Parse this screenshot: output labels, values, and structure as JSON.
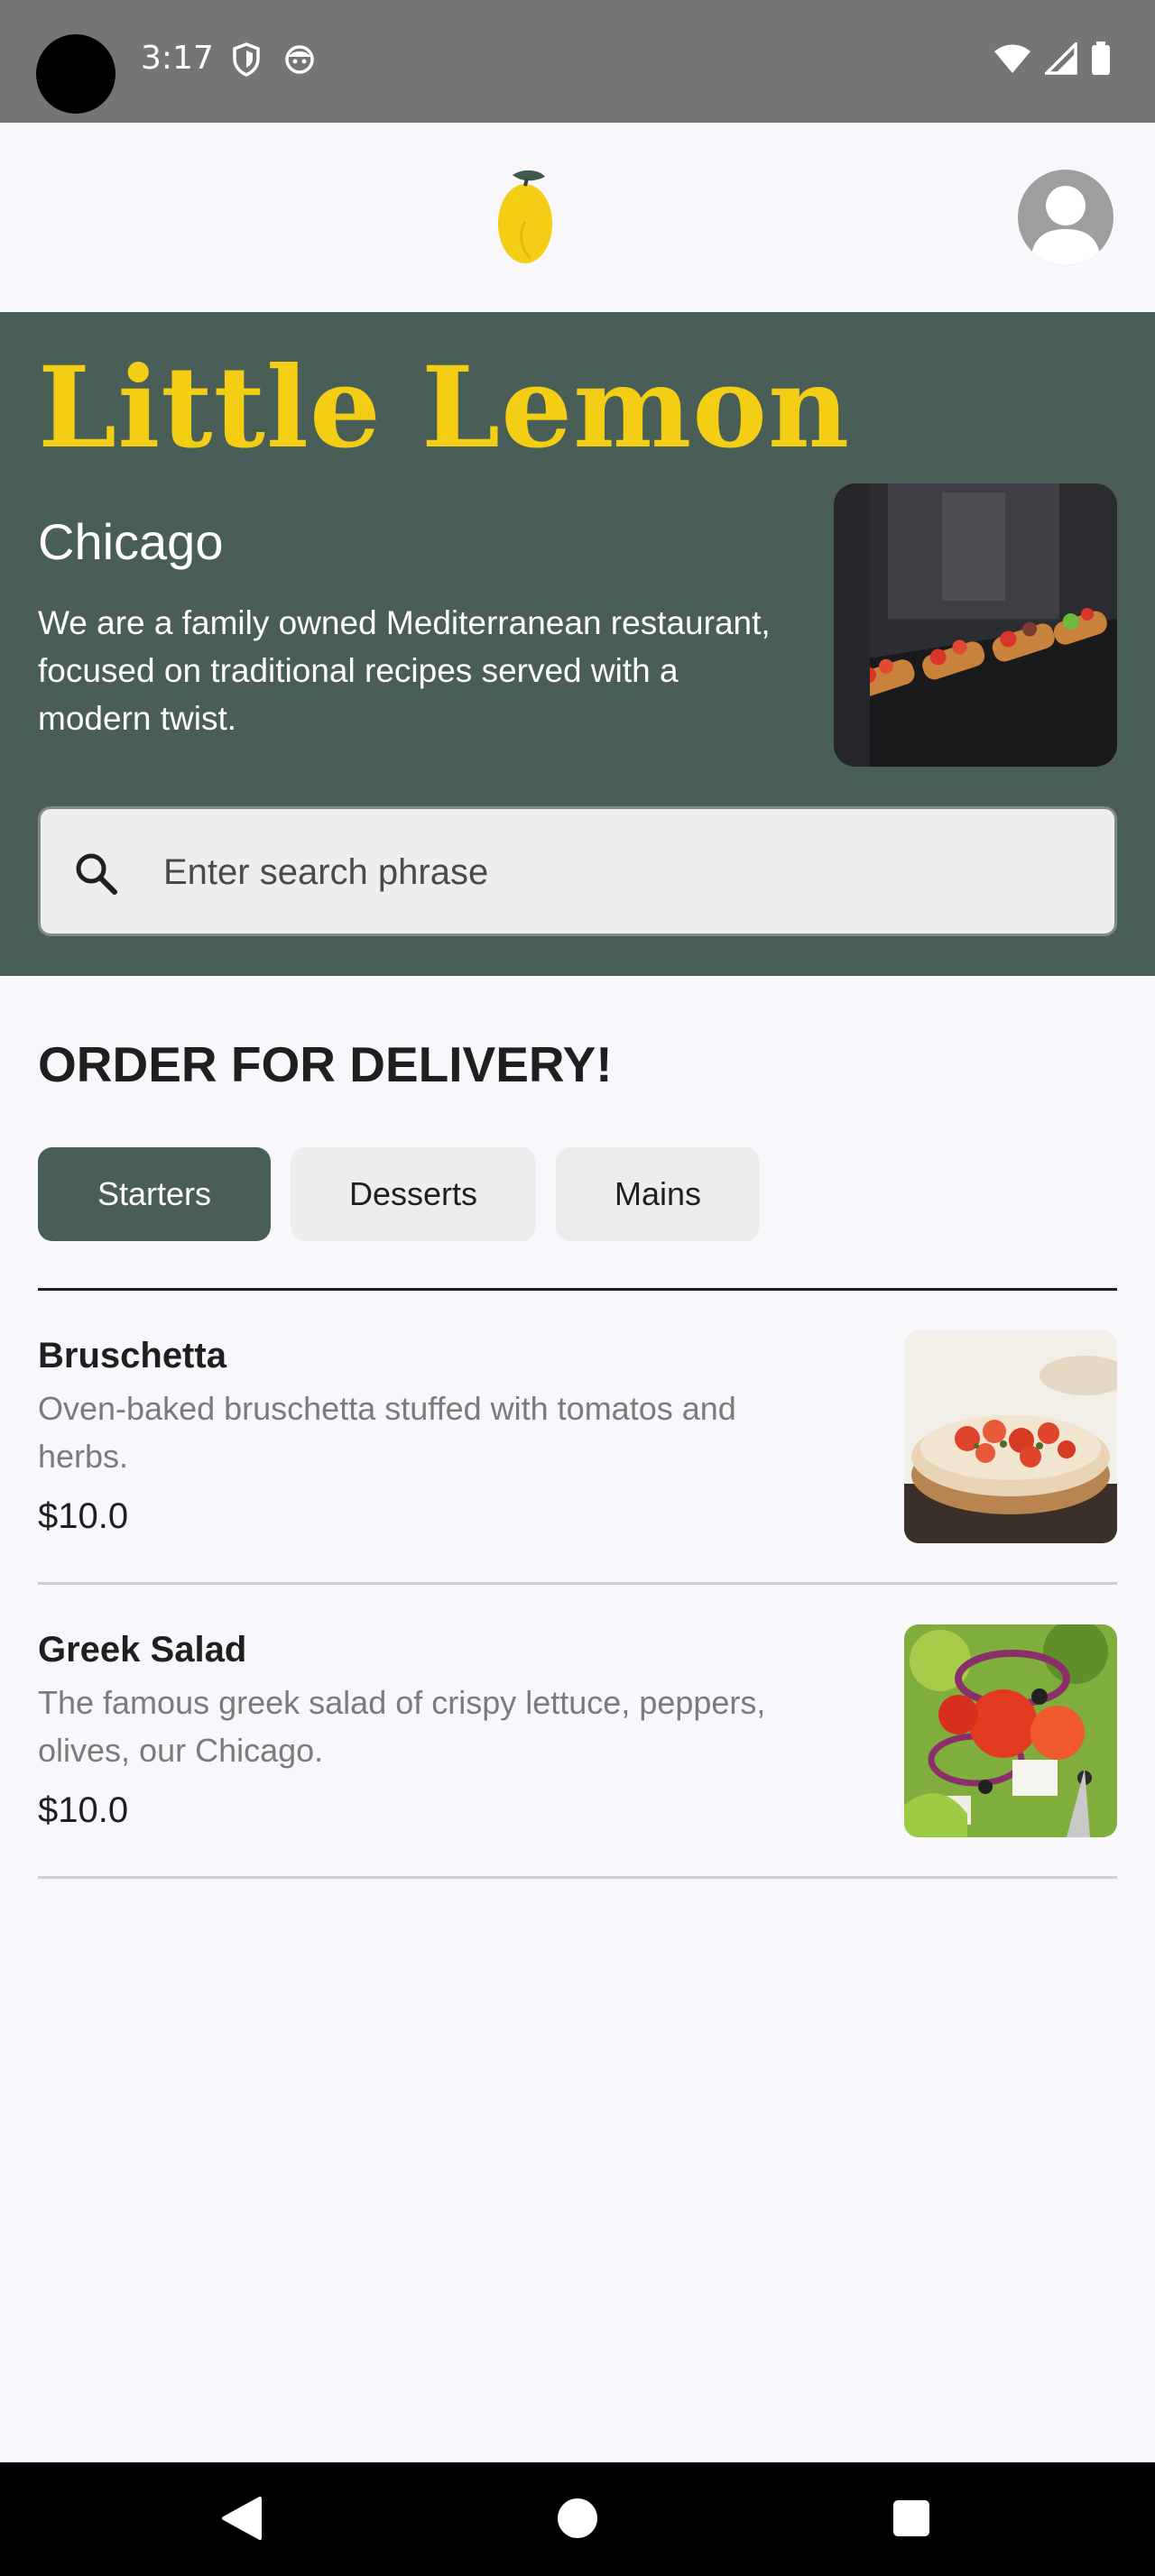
{
  "status_bar": {
    "time": "3:17",
    "icons_left": [
      "shield-icon",
      "face-icon"
    ],
    "icons_right": [
      "wifi-icon",
      "signal-icon",
      "battery-icon"
    ]
  },
  "app_bar": {
    "logo_icon": "lemon-logo-icon",
    "profile_icon": "avatar-icon"
  },
  "hero": {
    "title": "Little Lemon",
    "city": "Chicago",
    "description": "We are a family owned Mediterranean restaurant, focused on traditional recipes served with a modern twist.",
    "search_placeholder": "Enter search phrase",
    "search_value": ""
  },
  "order": {
    "title": "ORDER FOR DELIVERY!",
    "tabs": [
      {
        "label": "Starters",
        "active": true
      },
      {
        "label": "Desserts",
        "active": false
      },
      {
        "label": "Mains",
        "active": false
      }
    ]
  },
  "menu": [
    {
      "name": "Bruschetta",
      "description": "Oven-baked bruschetta stuffed with tomatos and herbs.",
      "price": "$10.0"
    },
    {
      "name": "Greek Salad",
      "description": "The famous greek salad of crispy lettuce, peppers, olives, our Chicago.",
      "price": "$10.0"
    }
  ],
  "colors": {
    "primary": "#495E57",
    "accent": "#F4CE14",
    "background": "#F8F7FC"
  }
}
